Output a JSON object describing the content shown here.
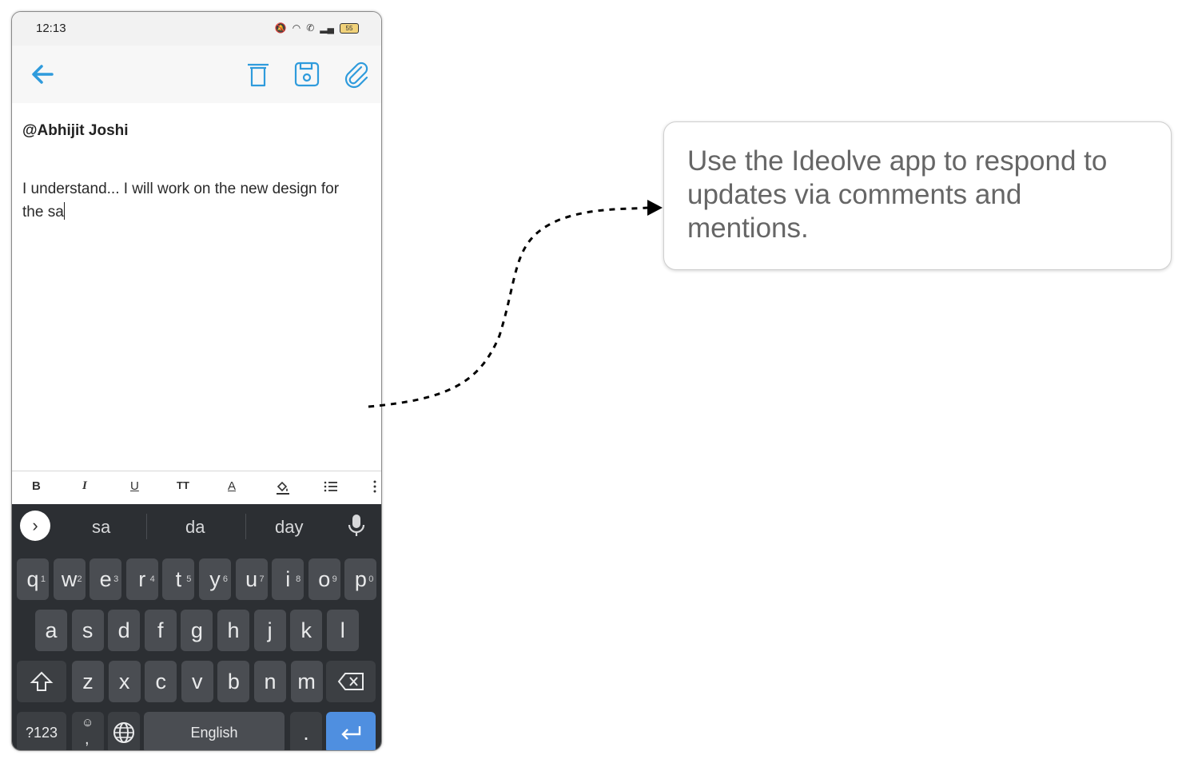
{
  "status_bar": {
    "time": "12:13",
    "battery": "55"
  },
  "app_bar": {
    "back_icon": "arrow-left-icon",
    "actions": [
      "trash-icon",
      "save-icon",
      "paperclip-icon"
    ],
    "accent": "#2f9bdc"
  },
  "editor": {
    "mention": "@Abhijit Joshi",
    "text_line1": "I understand... I will work on the new design for",
    "text_line2": "the sa"
  },
  "format_toolbar": {
    "bold": "B",
    "italic": "I",
    "underline": "U",
    "text_size": "TT",
    "text_color": "A"
  },
  "keyboard": {
    "suggestions": [
      "sa",
      "da",
      "day"
    ],
    "row1": [
      {
        "k": "q",
        "h": "1"
      },
      {
        "k": "w",
        "h": "2"
      },
      {
        "k": "e",
        "h": "3"
      },
      {
        "k": "r",
        "h": "4"
      },
      {
        "k": "t",
        "h": "5"
      },
      {
        "k": "y",
        "h": "6"
      },
      {
        "k": "u",
        "h": "7"
      },
      {
        "k": "i",
        "h": "8"
      },
      {
        "k": "o",
        "h": "9"
      },
      {
        "k": "p",
        "h": "0"
      }
    ],
    "row2": [
      "a",
      "s",
      "d",
      "f",
      "g",
      "h",
      "j",
      "k",
      "l"
    ],
    "row3": [
      "z",
      "x",
      "c",
      "v",
      "b",
      "n",
      "m"
    ],
    "symbols_label": "?123",
    "emoji_comma": ",",
    "space_label": "English",
    "period": "."
  },
  "callout": {
    "text": "Use the Ideolve app to respond to updates via comments and mentions."
  }
}
